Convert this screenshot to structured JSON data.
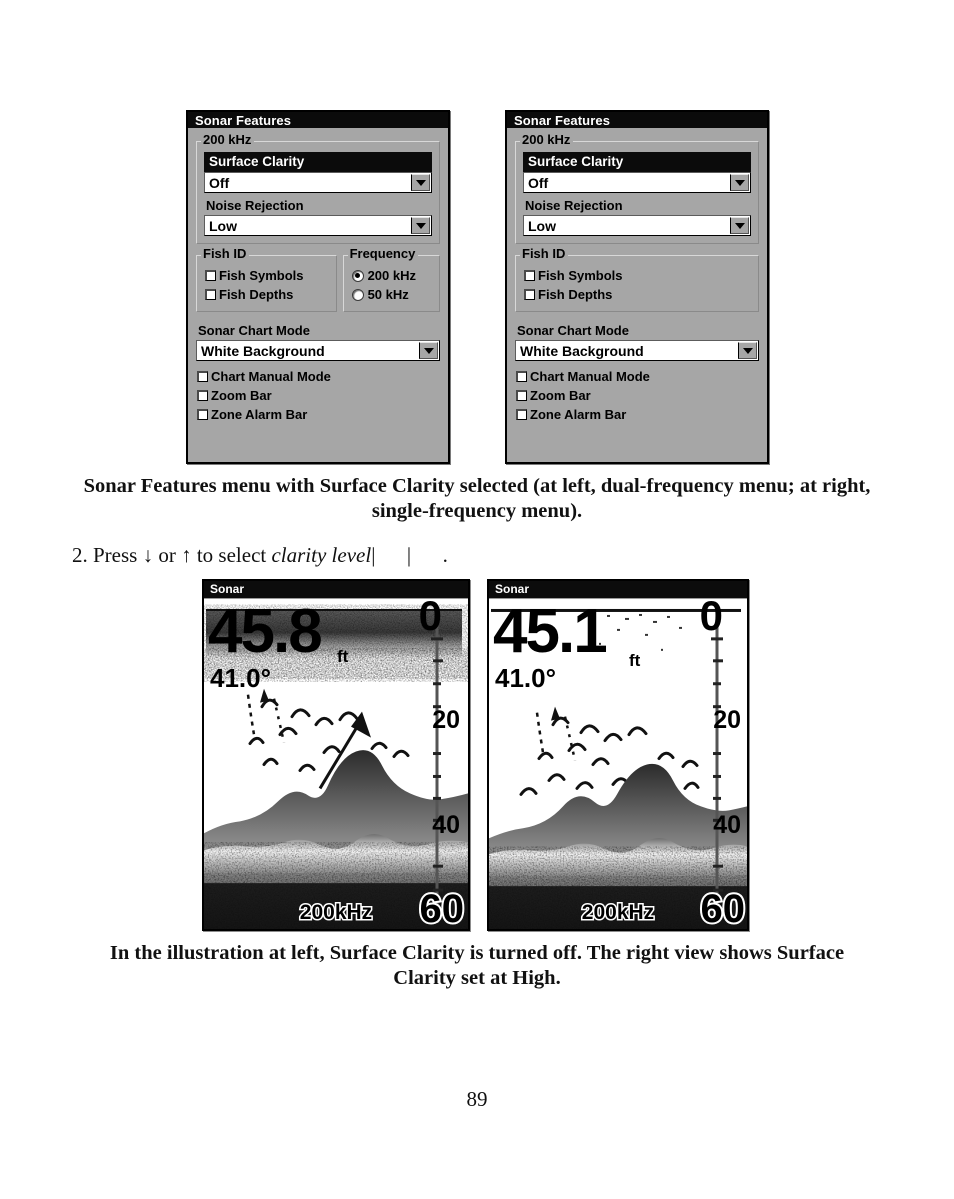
{
  "page": {
    "number": "89"
  },
  "menus": [
    {
      "id": "dual-frequency",
      "title": "Sonar Features",
      "group_200khz": {
        "legend": "200 kHz",
        "selected_item": "Surface Clarity",
        "surface_clarity_value": "Off",
        "noise_rejection_label": "Noise Rejection",
        "noise_rejection_value": "Low"
      },
      "fish_id": {
        "legend": "Fish ID",
        "items": [
          {
            "label": "Fish Symbols",
            "checked": false
          },
          {
            "label": "Fish Depths",
            "checked": false
          }
        ]
      },
      "frequency": {
        "legend": "Frequency",
        "options": [
          {
            "label": "200 kHz",
            "selected": true
          },
          {
            "label": "50 kHz",
            "selected": false
          }
        ]
      },
      "sonar_chart_mode": {
        "label": "Sonar Chart Mode",
        "value": "White Background"
      },
      "toggles": [
        {
          "label": "Chart Manual Mode",
          "checked": false
        },
        {
          "label": "Zoom Bar",
          "checked": false
        },
        {
          "label": "Zone Alarm Bar",
          "checked": false
        }
      ]
    },
    {
      "id": "single-frequency",
      "title": "Sonar Features",
      "group_200khz": {
        "legend": "200 kHz",
        "selected_item": "Surface Clarity",
        "surface_clarity_value": "Off",
        "noise_rejection_label": "Noise Rejection",
        "noise_rejection_value": "Low"
      },
      "fish_id": {
        "legend": "Fish ID",
        "items": [
          {
            "label": "Fish Symbols",
            "checked": false
          },
          {
            "label": "Fish Depths",
            "checked": false
          }
        ]
      },
      "sonar_chart_mode": {
        "label": "Sonar Chart Mode",
        "value": "White Background"
      },
      "toggles": [
        {
          "label": "Chart Manual Mode",
          "checked": false
        },
        {
          "label": "Zoom Bar",
          "checked": false
        },
        {
          "label": "Zone Alarm Bar",
          "checked": false
        }
      ]
    }
  ],
  "caption_menus": "Sonar Features menu with Surface Clarity selected (at left, dual-frequency menu; at right, single-frequency menu).",
  "step": {
    "prefix": "2. Press ↓ or ↑ to select ",
    "italic": "clarity level",
    "suffix": "|      |      ."
  },
  "sonar_screens": [
    {
      "id": "surface-clarity-off",
      "title": "Sonar",
      "depth": "45.8",
      "depth_unit": "ft",
      "temperature": "41.0°",
      "frequency": "200kHz",
      "scale_labels": [
        "0",
        "20",
        "40",
        "60"
      ],
      "has_arrow_annotation": true
    },
    {
      "id": "surface-clarity-high",
      "title": "Sonar",
      "depth": "45.1",
      "depth_unit": "ft",
      "temperature": "41.0°",
      "frequency": "200kHz",
      "scale_labels": [
        "0",
        "20",
        "40",
        "60"
      ],
      "has_arrow_annotation": false
    }
  ],
  "caption_sonar": "In the illustration at left, Surface Clarity is turned off. The right view shows Surface Clarity set at High."
}
